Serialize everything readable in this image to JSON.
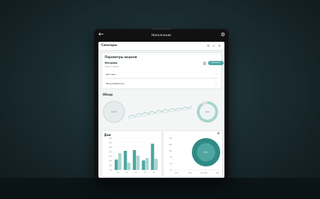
{
  "device": {
    "top_title": "Наполнение",
    "back_icon": "arrow-left-icon",
    "settings_icon": "gear-icon"
  },
  "section1": {
    "title": "Сенсоры",
    "actions": [
      "b",
      "c",
      "d"
    ],
    "card_title": "Параметры модели",
    "sub_title": "Метрики",
    "sub_caption": "datum datum",
    "button_label": "Обновить",
    "rows": [
      "Датчики",
      "Весы/обработка"
    ]
  },
  "section2": {
    "title": "Обзор",
    "left_donut_label": "100%",
    "right_donut_label": "90%"
  },
  "bar_card": {
    "title": "Дом",
    "y_ticks": [
      "400",
      "350",
      "300",
      "250",
      "200",
      "150",
      "100",
      "50"
    ],
    "x_ticks": [
      "01",
      "02",
      "03",
      "04",
      "05"
    ]
  },
  "donut_card": {
    "settings_icon": "gear-icon",
    "y_ticks": [
      "150",
      "125",
      "100",
      "75",
      "50",
      "25"
    ],
    "x_ticks": [
      "015",
      "016",
      "100 000",
      "200"
    ],
    "center_label": "96%"
  },
  "chart_data": [
    {
      "type": "bar",
      "categories": [
        "01",
        "02",
        "03",
        "04",
        "05"
      ],
      "series": [
        {
          "values": [
            130,
            240,
            250,
            120,
            330
          ]
        },
        {
          "values": [
            210,
            90,
            180,
            150,
            140
          ]
        }
      ],
      "ylim": [
        0,
        400
      ]
    },
    {
      "type": "line",
      "x": [
        0,
        1,
        2,
        3,
        4,
        5,
        6,
        7,
        8,
        9,
        10,
        11,
        12,
        13,
        14,
        15,
        16,
        17,
        18,
        19
      ],
      "series": [
        {
          "values": [
            40,
            45,
            42,
            50,
            47,
            52,
            49,
            55,
            51,
            58,
            54,
            60,
            57,
            62,
            59,
            63,
            61,
            66,
            63,
            68
          ]
        },
        {
          "values": [
            35,
            38,
            40,
            41,
            44,
            43,
            47,
            46,
            50,
            49,
            52,
            51,
            55,
            54,
            57,
            56,
            59,
            58,
            61,
            62
          ]
        }
      ]
    }
  ],
  "colors": {
    "teal": "#4fa5a0",
    "teal_light": "#a8d5cf",
    "teal_dark": "#2f8a84",
    "gray_donut": "#d9dfdf"
  }
}
